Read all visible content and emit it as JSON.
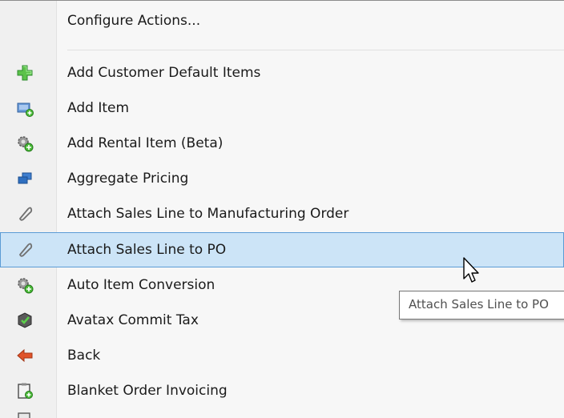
{
  "menu": {
    "configure_label": "Configure Actions...",
    "items": [
      {
        "label": "Add Customer Default Items",
        "icon": "green-plus-icon"
      },
      {
        "label": "Add Item",
        "icon": "add-item-icon"
      },
      {
        "label": "Add Rental Item (Beta)",
        "icon": "gear-plus-icon"
      },
      {
        "label": "Aggregate Pricing",
        "icon": "stacked-windows-icon"
      },
      {
        "label": "Attach Sales Line to Manufacturing Order",
        "icon": "paperclip-icon"
      },
      {
        "label": "Attach Sales Line to PO",
        "icon": "paperclip-icon"
      },
      {
        "label": "Auto Item Conversion",
        "icon": "gear-plus-icon"
      },
      {
        "label": "Avatax Commit Tax",
        "icon": "avatax-icon"
      },
      {
        "label": "Back",
        "icon": "back-arrow-icon"
      },
      {
        "label": "Blanket Order Invoicing",
        "icon": "clipboard-plus-icon"
      }
    ],
    "highlighted_label": "Attach Sales Line to PO"
  },
  "tooltip": {
    "text": "Attach Sales Line to PO"
  },
  "colors": {
    "highlight": "#cce4f7",
    "highlight_border": "#5b9bd5"
  }
}
